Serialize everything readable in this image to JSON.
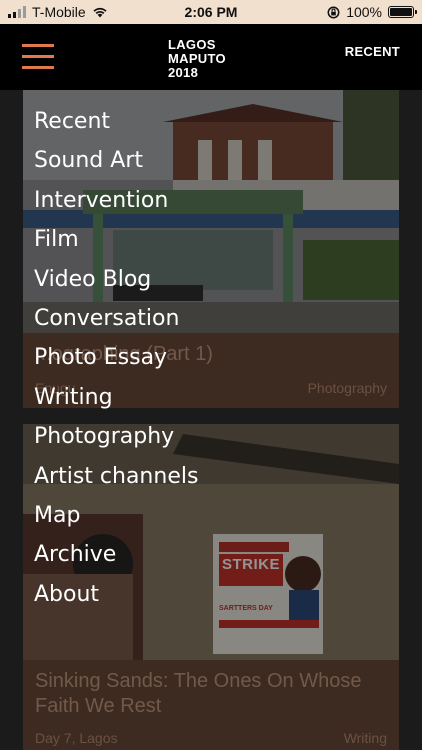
{
  "status_bar": {
    "carrier": "T-Mobile",
    "time": "2:06 PM",
    "battery_percent": "100%"
  },
  "header": {
    "logo_lines": [
      "LAGOS",
      "MAPUTO",
      "2018"
    ],
    "recent_label": "RECENT",
    "accent_color": "#e07a4c"
  },
  "menu": {
    "items": [
      {
        "label": "Recent"
      },
      {
        "label": "Sound Art"
      },
      {
        "label": "Intervention"
      },
      {
        "label": "Film"
      },
      {
        "label": "Video Blog"
      },
      {
        "label": "Conversation"
      },
      {
        "label": "Photo Essay"
      },
      {
        "label": "Writing"
      },
      {
        "label": "Photography"
      },
      {
        "label": "Artist channels"
      },
      {
        "label": "Map"
      },
      {
        "label": "Archive"
      },
      {
        "label": "About"
      }
    ]
  },
  "feed": {
    "cards": [
      {
        "title": "...ographing (Part 1)",
        "meta": "Enugu",
        "category": "Photography"
      },
      {
        "title_lines": [
          "Sinking Sands: The Ones On Whose",
          "Faith We Rest"
        ],
        "meta": "Day 7, Lagos",
        "category": "Writing",
        "poster": {
          "headline": "STRIKE",
          "subline": "SARTTERS DAY"
        }
      }
    ]
  }
}
